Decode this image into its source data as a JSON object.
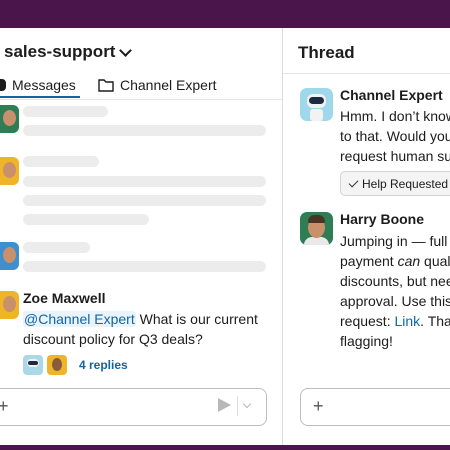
{
  "channel": {
    "name": "sales-support"
  },
  "tabs": [
    {
      "label": "Messages",
      "icon": "speech-bubble-icon"
    },
    {
      "label": "Channel Expert",
      "icon": "folder-icon"
    }
  ],
  "message": {
    "author": "Zoe Maxwell",
    "mention": "@Channel Expert",
    "text": " What is our current discount policy for Q3 deals?",
    "replies": "4 replies"
  },
  "thread": {
    "title": "Thread",
    "messages": [
      {
        "author": "Channel Expert",
        "lines": [
          "Hmm. I don’t know",
          "to that. Would you",
          "request human sup"
        ],
        "button": "Help Requested"
      },
      {
        "author": "Harry Boone",
        "line1": "Jumping in — full u",
        "line2_pre": "payment ",
        "line2_em": "can",
        "line2_post": " qualif",
        "line3": "discounts, but need",
        "line4": "approval. Use this t",
        "line5_pre": "request: ",
        "line5_link": "Link",
        "line5_post": ". Than",
        "line6": "flagging!"
      }
    ]
  },
  "colors": {
    "brand": "#4a154b",
    "link": "#1264a3"
  }
}
